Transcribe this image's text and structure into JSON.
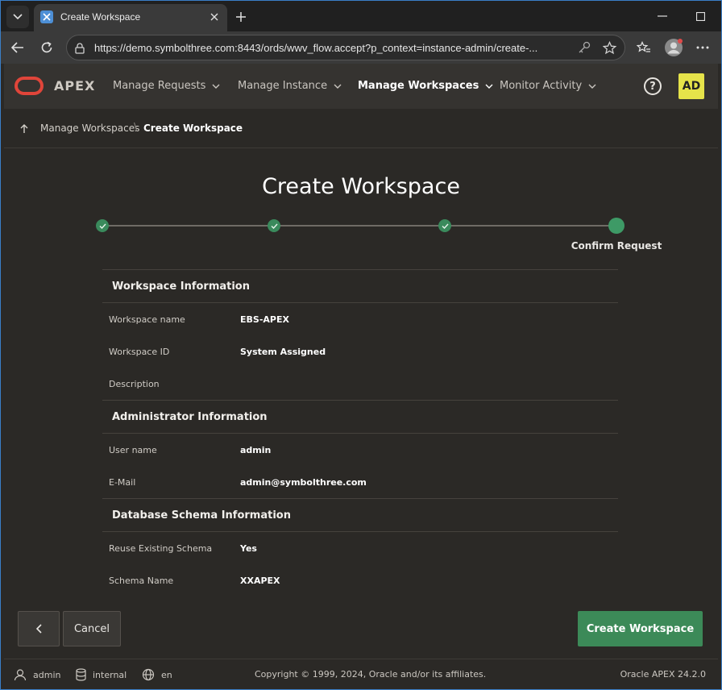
{
  "browser": {
    "tab_title": "Create Workspace",
    "url": "https://demo.symbolthree.com:8443/ords/wwv_flow.accept?p_context=instance-admin/create-..."
  },
  "header": {
    "logo_text": "APEX",
    "menu": [
      {
        "label": "Manage Requests"
      },
      {
        "label": "Manage Instance"
      },
      {
        "label": "Manage Workspaces"
      },
      {
        "label": "Monitor Activity"
      }
    ],
    "help_label": "?",
    "avatar_initials": "AD",
    "avatar_color": "#e6e34a",
    "logo_color": "#e0453a"
  },
  "breadcrumb": {
    "parent": "Manage Workspaces",
    "separator": "\\",
    "current": "Create Workspace"
  },
  "page": {
    "title": "Create Workspace",
    "wizard": {
      "current_step_label": "Confirm Request",
      "steps_total": 4,
      "steps_completed": 3
    },
    "sections": [
      {
        "title": "Workspace Information",
        "rows": [
          {
            "label": "Workspace name",
            "value": "EBS-APEX"
          },
          {
            "label": "Workspace ID",
            "value": "System Assigned"
          },
          {
            "label": "Description",
            "value": ""
          }
        ]
      },
      {
        "title": "Administrator Information",
        "rows": [
          {
            "label": "User name",
            "value": "admin"
          },
          {
            "label": "E-Mail",
            "value": "admin@symbolthree.com"
          }
        ]
      },
      {
        "title": "Database Schema Information",
        "rows": [
          {
            "label": "Reuse Existing Schema",
            "value": "Yes"
          },
          {
            "label": "Schema Name",
            "value": "XXAPEX"
          }
        ]
      }
    ]
  },
  "actions": {
    "cancel_label": "Cancel",
    "create_label": "Create Workspace",
    "create_color": "#3c8a58"
  },
  "status_bar": {
    "user": "admin",
    "database": "internal",
    "language": "en",
    "copyright": "Copyright © 1999, 2024, Oracle and/or its affiliates.",
    "version": "Oracle APEX 24.2.0"
  }
}
